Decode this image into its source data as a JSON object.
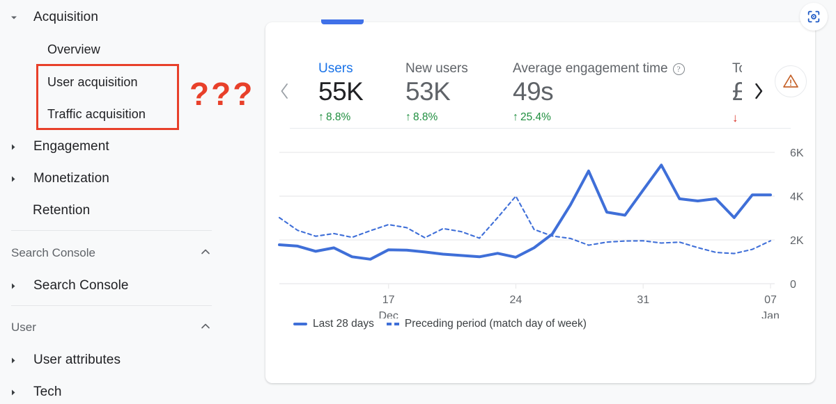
{
  "sidebar": {
    "items": [
      {
        "label": "Acquisition",
        "type": "group",
        "expanded": true,
        "caret": "caret-down-icon"
      },
      {
        "label": "Overview",
        "type": "child",
        "caret": null
      },
      {
        "label": "User acquisition",
        "type": "child",
        "caret": null
      },
      {
        "label": "Traffic acquisition",
        "type": "child",
        "caret": null
      },
      {
        "label": "Engagement",
        "type": "group",
        "expanded": false,
        "caret": "caret-right-icon"
      },
      {
        "label": "Monetization",
        "type": "group",
        "expanded": false,
        "caret": "caret-right-icon"
      },
      {
        "label": "Retention",
        "type": "child",
        "caret": null
      }
    ],
    "sections": [
      {
        "title": "Search Console",
        "collapse_icon": "chevron-up-icon",
        "items": [
          {
            "label": "Search Console",
            "caret": "caret-right-icon"
          }
        ]
      },
      {
        "title": "User",
        "collapse_icon": "chevron-up-icon",
        "items": [
          {
            "label": "User attributes",
            "caret": "caret-right-icon"
          },
          {
            "label": "Tech",
            "caret": "caret-right-icon"
          }
        ]
      }
    ],
    "annotation": {
      "question_marks": "???",
      "box_color": "#e8402a"
    }
  },
  "card": {
    "pager_prev_icon": "chevron-left-icon",
    "pager_next_icon": "chevron-right-icon",
    "warning_icon": "warning-triangle-icon",
    "active_tab_color": "#4071e8",
    "metrics": [
      {
        "label": "Users",
        "value": "55K",
        "delta": "8.8%",
        "direction": "up",
        "active": true,
        "help": false
      },
      {
        "label": "New users",
        "value": "53K",
        "delta": "8.8%",
        "direction": "up",
        "active": false,
        "help": false
      },
      {
        "label": "Average engagement time",
        "value": "49s",
        "delta": "25.4%",
        "direction": "up",
        "active": false,
        "help": true
      },
      {
        "label": "To",
        "value": "£",
        "delta": "",
        "direction": "down",
        "active": false,
        "help": false
      }
    ]
  },
  "legend": {
    "current_label": "Last 28 days",
    "previous_label": "Preceding period (match day of week)"
  },
  "lens_button": {
    "icon": "lens-scan-icon"
  },
  "chart_data": {
    "type": "line",
    "title": "",
    "xlabel": "",
    "ylabel": "",
    "ylim": [
      0,
      6800
    ],
    "grid": true,
    "gridlines": [
      0,
      2000,
      4000,
      6000
    ],
    "ytick_labels": [
      "0",
      "2K",
      "4K",
      "6K"
    ],
    "xtick_labels": [
      "17",
      "24",
      "31",
      "07"
    ],
    "xtick_sublabels": [
      "Dec",
      "",
      "",
      "Jan"
    ],
    "xtick_positions": [
      6,
      13,
      20,
      27
    ],
    "legend_position": "bottom-left",
    "x": [
      0,
      1,
      2,
      3,
      4,
      5,
      6,
      7,
      8,
      9,
      10,
      11,
      12,
      13,
      14,
      15,
      16,
      17,
      18,
      19,
      20,
      21,
      22,
      23,
      24,
      25,
      26,
      27
    ],
    "series": [
      {
        "name": "Last 28 days",
        "style": "solid",
        "color": "#3f6fd8",
        "values": [
          1780,
          1720,
          1480,
          1640,
          1230,
          1120,
          1550,
          1530,
          1450,
          1350,
          1290,
          1230,
          1390,
          1210,
          1640,
          2270,
          3600,
          5150,
          3270,
          3130,
          4280,
          5420,
          3880,
          3780,
          3880,
          3020,
          4060,
          4060
        ]
      },
      {
        "name": "Preceding period (match day of week)",
        "style": "dashed",
        "color": "#3f6fd8",
        "values": [
          3020,
          2440,
          2170,
          2290,
          2120,
          2420,
          2700,
          2560,
          2100,
          2520,
          2380,
          2080,
          3020,
          4000,
          2480,
          2180,
          2070,
          1760,
          1900,
          1950,
          1960,
          1860,
          1900,
          1650,
          1430,
          1380,
          1570,
          1960
        ]
      }
    ]
  }
}
